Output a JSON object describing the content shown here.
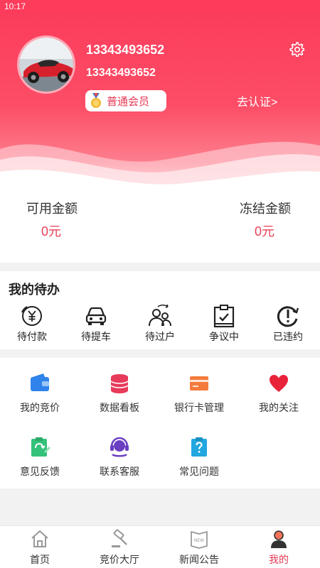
{
  "status_bar": {
    "time": "10:17"
  },
  "profile": {
    "phone_title": "13343493652",
    "phone_sub": "13343493652",
    "member_level": "普通会员",
    "certify_label": "去认证>"
  },
  "balance": {
    "available_label": "可用金额",
    "available_value": "0元",
    "frozen_label": "冻结金额",
    "frozen_value": "0元"
  },
  "todo": {
    "title": "我的待办",
    "items": [
      {
        "label": "待付款",
        "icon": "yen-coin-icon"
      },
      {
        "label": "待提车",
        "icon": "car-icon"
      },
      {
        "label": "待过户",
        "icon": "transfer-users-icon"
      },
      {
        "label": "争议中",
        "icon": "dispute-clipboard-icon"
      },
      {
        "label": "已违约",
        "icon": "alert-circle-icon"
      }
    ]
  },
  "services": [
    {
      "label": "我的竞价",
      "icon": "wallet-icon"
    },
    {
      "label": "数据看板",
      "icon": "database-icon"
    },
    {
      "label": "银行卡管理",
      "icon": "bank-card-icon"
    },
    {
      "label": "我的关注",
      "icon": "heart-icon"
    },
    {
      "label": "意见反馈",
      "icon": "feedback-icon"
    },
    {
      "label": "联系客服",
      "icon": "customer-service-icon"
    },
    {
      "label": "常见问题",
      "icon": "faq-icon"
    }
  ],
  "tabbar": [
    {
      "label": "首页",
      "icon": "home-icon"
    },
    {
      "label": "竞价大厅",
      "icon": "gavel-icon"
    },
    {
      "label": "新闻公告",
      "icon": "news-icon"
    },
    {
      "label": "我的",
      "icon": "user-icon",
      "active": true
    }
  ],
  "colors": {
    "brand": "#fb3a5a",
    "accent_text": "#e84057",
    "active_tab": "#e33a55"
  }
}
